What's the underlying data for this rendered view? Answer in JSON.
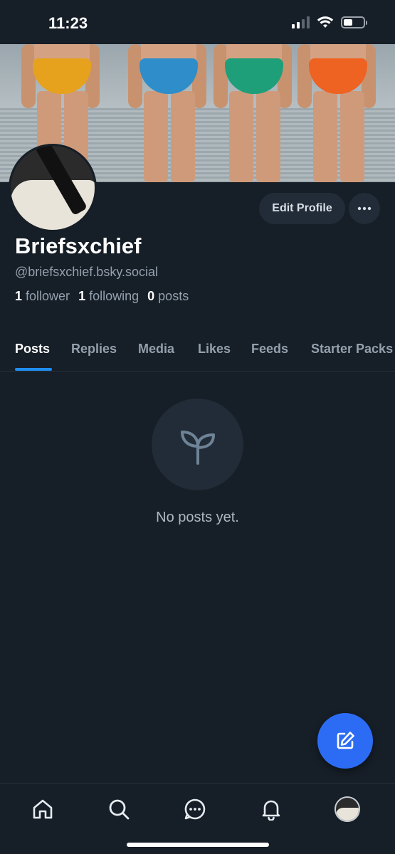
{
  "status_bar": {
    "time": "11:23"
  },
  "profile": {
    "display_name": "Briefsxchief",
    "handle": "@briefsxchief.bsky.social",
    "followers_count": "1",
    "followers_label": "follower",
    "following_count": "1",
    "following_label": "following",
    "posts_count": "0",
    "posts_label": "posts",
    "edit_label": "Edit Profile",
    "more_label": "···"
  },
  "tabs": [
    {
      "label": "Posts",
      "active": true
    },
    {
      "label": "Replies",
      "active": false
    },
    {
      "label": "Media",
      "active": false
    },
    {
      "label": "Likes",
      "active": false
    },
    {
      "label": "Feeds",
      "active": false
    },
    {
      "label": "Starter Packs",
      "active": false
    }
  ],
  "empty_state": {
    "text": "No posts yet.",
    "icon": "sprout-icon"
  },
  "fab": {
    "icon": "compose-icon"
  },
  "bottom_nav": [
    {
      "icon": "home-icon"
    },
    {
      "icon": "search-icon"
    },
    {
      "icon": "chat-icon"
    },
    {
      "icon": "bell-icon"
    },
    {
      "icon": "avatar"
    }
  ],
  "colors": {
    "background": "#161e27",
    "accent": "#1f8cf0",
    "fab": "#2c6cf5",
    "muted_text": "#94a0ad"
  }
}
